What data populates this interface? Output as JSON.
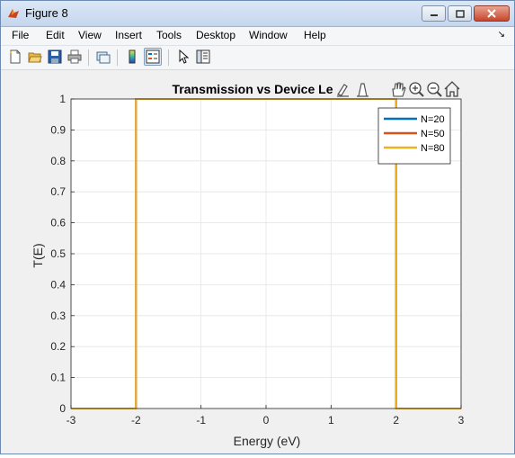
{
  "window": {
    "title": "Figure 8"
  },
  "menu": [
    "File",
    "Edit",
    "View",
    "Insert",
    "Tools",
    "Desktop",
    "Window",
    "Help"
  ],
  "toolbar": {
    "buttons": [
      "new-figure-icon",
      "open-file-icon",
      "save-icon",
      "print-icon",
      "link-plot-icon",
      "colorbar-icon",
      "legend-icon",
      "pointer-icon",
      "plot-browser-icon"
    ],
    "pressed": "legend-icon"
  },
  "axes_toolbar": [
    "brush-icon",
    "data-cursor-icon",
    "zoom-in-icon",
    "zoom-out-icon",
    "pan-icon",
    "home-icon"
  ],
  "chart_data": {
    "type": "line",
    "title": "Transmission vs Device Le",
    "xlabel": "Energy (eV)",
    "ylabel": "T(E)",
    "xlim": [
      -3,
      3
    ],
    "ylim": [
      0,
      1
    ],
    "xticks": [
      -3,
      -2,
      -1,
      0,
      1,
      2,
      3
    ],
    "yticks": [
      0,
      0.1,
      0.2,
      0.3,
      0.4,
      0.5,
      0.6,
      0.7,
      0.8,
      0.9,
      1
    ],
    "grid": true,
    "legend_position": "top-right",
    "series": [
      {
        "name": "N=20",
        "color": "#0072bd",
        "x": [
          -3,
          -2,
          -2,
          2,
          2,
          3
        ],
        "y": [
          0,
          0,
          1,
          1,
          0,
          0
        ]
      },
      {
        "name": "N=50",
        "color": "#d95319",
        "x": [
          -3,
          -2,
          -2,
          2,
          2,
          3
        ],
        "y": [
          0,
          0,
          1,
          1,
          0,
          0
        ]
      },
      {
        "name": "N=80",
        "color": "#edb120",
        "x": [
          -3,
          -2,
          -2,
          2,
          2,
          3
        ],
        "y": [
          0,
          0,
          1,
          1,
          0,
          0
        ]
      }
    ]
  }
}
